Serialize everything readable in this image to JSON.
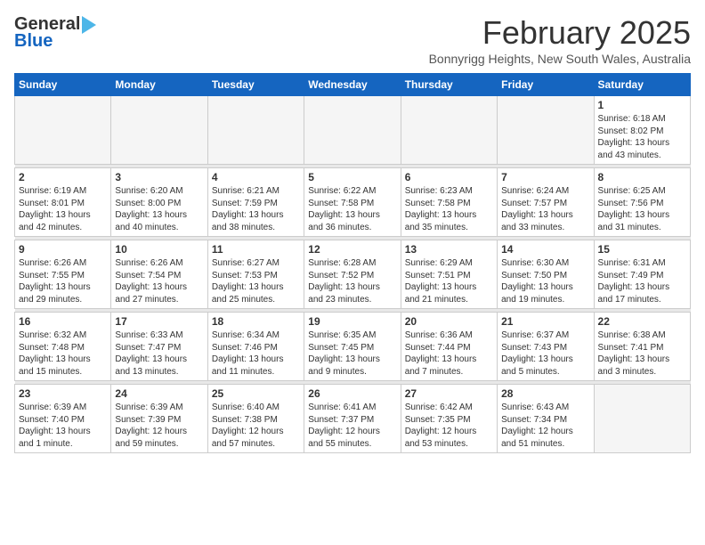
{
  "header": {
    "logo_general": "General",
    "logo_blue": "Blue",
    "month": "February 2025",
    "location": "Bonnyrigg Heights, New South Wales, Australia"
  },
  "weekdays": [
    "Sunday",
    "Monday",
    "Tuesday",
    "Wednesday",
    "Thursday",
    "Friday",
    "Saturday"
  ],
  "weeks": [
    [
      {
        "day": "",
        "info": ""
      },
      {
        "day": "",
        "info": ""
      },
      {
        "day": "",
        "info": ""
      },
      {
        "day": "",
        "info": ""
      },
      {
        "day": "",
        "info": ""
      },
      {
        "day": "",
        "info": ""
      },
      {
        "day": "1",
        "info": "Sunrise: 6:18 AM\nSunset: 8:02 PM\nDaylight: 13 hours\nand 43 minutes."
      }
    ],
    [
      {
        "day": "2",
        "info": "Sunrise: 6:19 AM\nSunset: 8:01 PM\nDaylight: 13 hours\nand 42 minutes."
      },
      {
        "day": "3",
        "info": "Sunrise: 6:20 AM\nSunset: 8:00 PM\nDaylight: 13 hours\nand 40 minutes."
      },
      {
        "day": "4",
        "info": "Sunrise: 6:21 AM\nSunset: 7:59 PM\nDaylight: 13 hours\nand 38 minutes."
      },
      {
        "day": "5",
        "info": "Sunrise: 6:22 AM\nSunset: 7:58 PM\nDaylight: 13 hours\nand 36 minutes."
      },
      {
        "day": "6",
        "info": "Sunrise: 6:23 AM\nSunset: 7:58 PM\nDaylight: 13 hours\nand 35 minutes."
      },
      {
        "day": "7",
        "info": "Sunrise: 6:24 AM\nSunset: 7:57 PM\nDaylight: 13 hours\nand 33 minutes."
      },
      {
        "day": "8",
        "info": "Sunrise: 6:25 AM\nSunset: 7:56 PM\nDaylight: 13 hours\nand 31 minutes."
      }
    ],
    [
      {
        "day": "9",
        "info": "Sunrise: 6:26 AM\nSunset: 7:55 PM\nDaylight: 13 hours\nand 29 minutes."
      },
      {
        "day": "10",
        "info": "Sunrise: 6:26 AM\nSunset: 7:54 PM\nDaylight: 13 hours\nand 27 minutes."
      },
      {
        "day": "11",
        "info": "Sunrise: 6:27 AM\nSunset: 7:53 PM\nDaylight: 13 hours\nand 25 minutes."
      },
      {
        "day": "12",
        "info": "Sunrise: 6:28 AM\nSunset: 7:52 PM\nDaylight: 13 hours\nand 23 minutes."
      },
      {
        "day": "13",
        "info": "Sunrise: 6:29 AM\nSunset: 7:51 PM\nDaylight: 13 hours\nand 21 minutes."
      },
      {
        "day": "14",
        "info": "Sunrise: 6:30 AM\nSunset: 7:50 PM\nDaylight: 13 hours\nand 19 minutes."
      },
      {
        "day": "15",
        "info": "Sunrise: 6:31 AM\nSunset: 7:49 PM\nDaylight: 13 hours\nand 17 minutes."
      }
    ],
    [
      {
        "day": "16",
        "info": "Sunrise: 6:32 AM\nSunset: 7:48 PM\nDaylight: 13 hours\nand 15 minutes."
      },
      {
        "day": "17",
        "info": "Sunrise: 6:33 AM\nSunset: 7:47 PM\nDaylight: 13 hours\nand 13 minutes."
      },
      {
        "day": "18",
        "info": "Sunrise: 6:34 AM\nSunset: 7:46 PM\nDaylight: 13 hours\nand 11 minutes."
      },
      {
        "day": "19",
        "info": "Sunrise: 6:35 AM\nSunset: 7:45 PM\nDaylight: 13 hours\nand 9 minutes."
      },
      {
        "day": "20",
        "info": "Sunrise: 6:36 AM\nSunset: 7:44 PM\nDaylight: 13 hours\nand 7 minutes."
      },
      {
        "day": "21",
        "info": "Sunrise: 6:37 AM\nSunset: 7:43 PM\nDaylight: 13 hours\nand 5 minutes."
      },
      {
        "day": "22",
        "info": "Sunrise: 6:38 AM\nSunset: 7:41 PM\nDaylight: 13 hours\nand 3 minutes."
      }
    ],
    [
      {
        "day": "23",
        "info": "Sunrise: 6:39 AM\nSunset: 7:40 PM\nDaylight: 13 hours\nand 1 minute."
      },
      {
        "day": "24",
        "info": "Sunrise: 6:39 AM\nSunset: 7:39 PM\nDaylight: 12 hours\nand 59 minutes."
      },
      {
        "day": "25",
        "info": "Sunrise: 6:40 AM\nSunset: 7:38 PM\nDaylight: 12 hours\nand 57 minutes."
      },
      {
        "day": "26",
        "info": "Sunrise: 6:41 AM\nSunset: 7:37 PM\nDaylight: 12 hours\nand 55 minutes."
      },
      {
        "day": "27",
        "info": "Sunrise: 6:42 AM\nSunset: 7:35 PM\nDaylight: 12 hours\nand 53 minutes."
      },
      {
        "day": "28",
        "info": "Sunrise: 6:43 AM\nSunset: 7:34 PM\nDaylight: 12 hours\nand 51 minutes."
      },
      {
        "day": "",
        "info": ""
      }
    ]
  ]
}
